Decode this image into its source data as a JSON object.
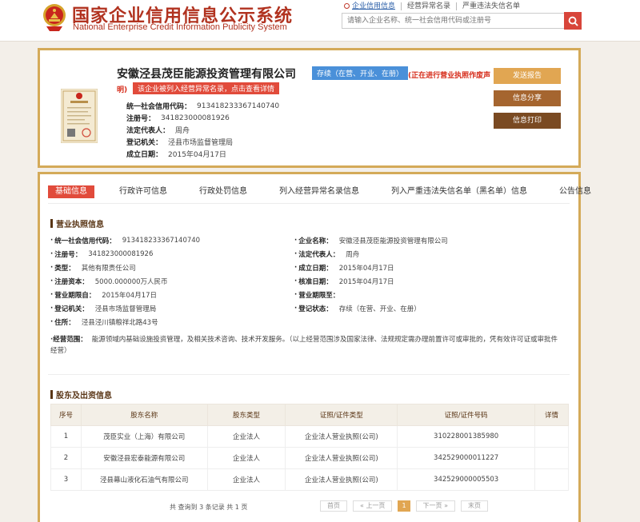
{
  "header": {
    "title_cn": "国家企业信用信息公示系统",
    "title_en": "National Enterprise Credit Information Publicity System",
    "search_tabs": [
      "企业信用信息",
      "经营异常名录",
      "严重违法失信名单"
    ],
    "search_placeholder": "请输入企业名称、统一社会信用代码或注册号"
  },
  "company": {
    "name": "安徽泾县茂臣能源投资管理有限公司",
    "status": "存续（在营、开业、在册）",
    "cancel_note": "(正在进行营业执照作废声",
    "cancel_note_tail": "明)",
    "abnormal_tag": "该企业被列入经营异常名录，点击查看详情",
    "info": [
      {
        "label": "统一社会信用代码：",
        "value": "913418233367140740"
      },
      {
        "label": "注册号：",
        "value": "341823000081926"
      },
      {
        "label": "法定代表人：",
        "value": "周舟"
      },
      {
        "label": "登记机关：",
        "value": "泾县市场监督管理局"
      },
      {
        "label": "成立日期：",
        "value": "2015年04月17日"
      }
    ],
    "buttons": {
      "report": "发送报告",
      "share": "信息分享",
      "print": "信息打印"
    }
  },
  "tabs": [
    "基础信息",
    "行政许可信息",
    "行政处罚信息",
    "列入经营异常名录信息",
    "列入严重违法失信名单（黑名单）信息",
    "公告信息"
  ],
  "license_section": {
    "title": "营业执照信息",
    "left": [
      {
        "label": "统一社会信用代码：",
        "value": "913418233367140740"
      },
      {
        "label": "注册号：",
        "value": "341823000081926"
      },
      {
        "label": "类型：",
        "value": "其他有限责任公司"
      },
      {
        "label": "注册资本：",
        "value": "5000.000000万人民币"
      },
      {
        "label": "营业期限自：",
        "value": "2015年04月17日"
      },
      {
        "label": "登记机关：",
        "value": "泾县市场监督管理局"
      },
      {
        "label": "住所：",
        "value": "泾县泾川镇粮祥北路43号"
      }
    ],
    "right": [
      {
        "label": "企业名称：",
        "value": "安徽泾县茂臣能源投资管理有限公司"
      },
      {
        "label": "法定代表人：",
        "value": "周舟"
      },
      {
        "label": "成立日期：",
        "value": "2015年04月17日"
      },
      {
        "label": "核准日期：",
        "value": "2015年04月17日"
      },
      {
        "label": "营业期限至：",
        "value": ""
      },
      {
        "label": "登记状态：",
        "value": "存续（在营、开业、在册）"
      }
    ],
    "scope_label": "经营范围：",
    "scope_value": "能源领域内基础设施投资管理，及相关技术咨询、技术开发服务。（以上经营范围涉及国家法律、法规规定需办理前置许可或审批的，凭有效许可证或审批件经营）"
  },
  "shareholders": {
    "title": "股东及出资信息",
    "columns": [
      "序号",
      "股东名称",
      "股东类型",
      "证照/证件类型",
      "证照/证件号码",
      "详情"
    ],
    "rows": [
      [
        "1",
        "茂臣实业（上海）有限公司",
        "企业法人",
        "企业法人营业执照(公司)",
        "310228001385980",
        ""
      ],
      [
        "2",
        "安徽泾县宏泰能源有限公司",
        "企业法人",
        "企业法人营业执照(公司)",
        "342529000011227",
        ""
      ],
      [
        "3",
        "泾县幕山液化石油气有限公司",
        "企业法人",
        "企业法人营业执照(公司)",
        "342529000005503",
        ""
      ]
    ],
    "pager_info": "共 查询到 3 条记录 共 1 页",
    "pager": [
      "首页",
      "« 上一页",
      "1",
      "下一页 »",
      "末页"
    ]
  },
  "colors": {
    "brand": "#b1321f",
    "gold_border": "#d4aa59",
    "accent_red": "#e14b3b",
    "status_blue": "#4a90d9"
  }
}
